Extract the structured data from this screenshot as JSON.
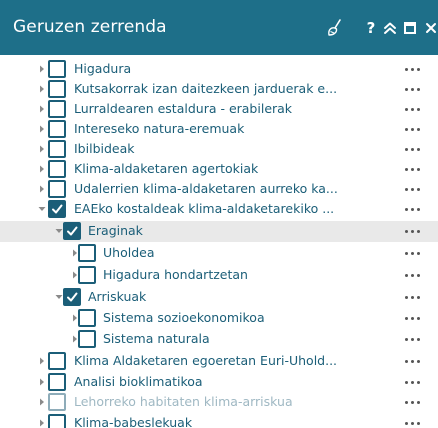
{
  "header": {
    "title": "Geruzen zerrenda",
    "help_label": "?",
    "icons": [
      "broom-icon",
      "help-icon",
      "collapse-icon",
      "maximize-icon",
      "close-icon"
    ],
    "background": "#1e6f89"
  },
  "tree": {
    "accent": "#1b5e78",
    "more_label": "•••",
    "items": [
      {
        "label": "Higadura",
        "level": 0,
        "expanded": false,
        "checked": false
      },
      {
        "label": "Kutsakorrak izan daitezkeen jarduerak e...",
        "level": 0,
        "expanded": false,
        "checked": false
      },
      {
        "label": "Lurraldearen estaldura - erabilerak",
        "level": 0,
        "expanded": false,
        "checked": false
      },
      {
        "label": "Intereseko natura-eremuak",
        "level": 0,
        "expanded": false,
        "checked": false
      },
      {
        "label": "Ibilbideak",
        "level": 0,
        "expanded": false,
        "checked": false
      },
      {
        "label": "Klima-aldaketaren agertokiak",
        "level": 0,
        "expanded": false,
        "checked": false
      },
      {
        "label": "Udalerrien klima-aldaketaren aurreko ka...",
        "level": 0,
        "expanded": false,
        "checked": false
      },
      {
        "label": "EAEko kostaldeak klima-aldaketarekiko ...",
        "level": 0,
        "expanded": true,
        "checked": true
      },
      {
        "label": "Eraginak",
        "level": 1,
        "expanded": true,
        "checked": true,
        "selected": true
      },
      {
        "label": "Uholdea",
        "level": 2,
        "expanded": false,
        "checked": false
      },
      {
        "label": "Higadura hondartzetan",
        "level": 2,
        "expanded": false,
        "checked": false
      },
      {
        "label": "Arriskuak",
        "level": 1,
        "expanded": true,
        "checked": true
      },
      {
        "label": "Sistema sozioekonomikoa",
        "level": 2,
        "expanded": false,
        "checked": false
      },
      {
        "label": "Sistema naturala",
        "level": 2,
        "expanded": false,
        "checked": false
      },
      {
        "label": "Klima Aldaketaren egoeretan Euri-Uhold...",
        "level": 0,
        "expanded": false,
        "checked": false
      },
      {
        "label": "Analisi bioklimatikoa",
        "level": 0,
        "expanded": false,
        "checked": false
      },
      {
        "label": "Lehorreko habitaten klima-arriskua",
        "level": 0,
        "expanded": false,
        "checked": false,
        "dimmed": true
      },
      {
        "label": "Klima-babeslekuak",
        "level": 0,
        "expanded": false,
        "checked": false
      }
    ]
  }
}
